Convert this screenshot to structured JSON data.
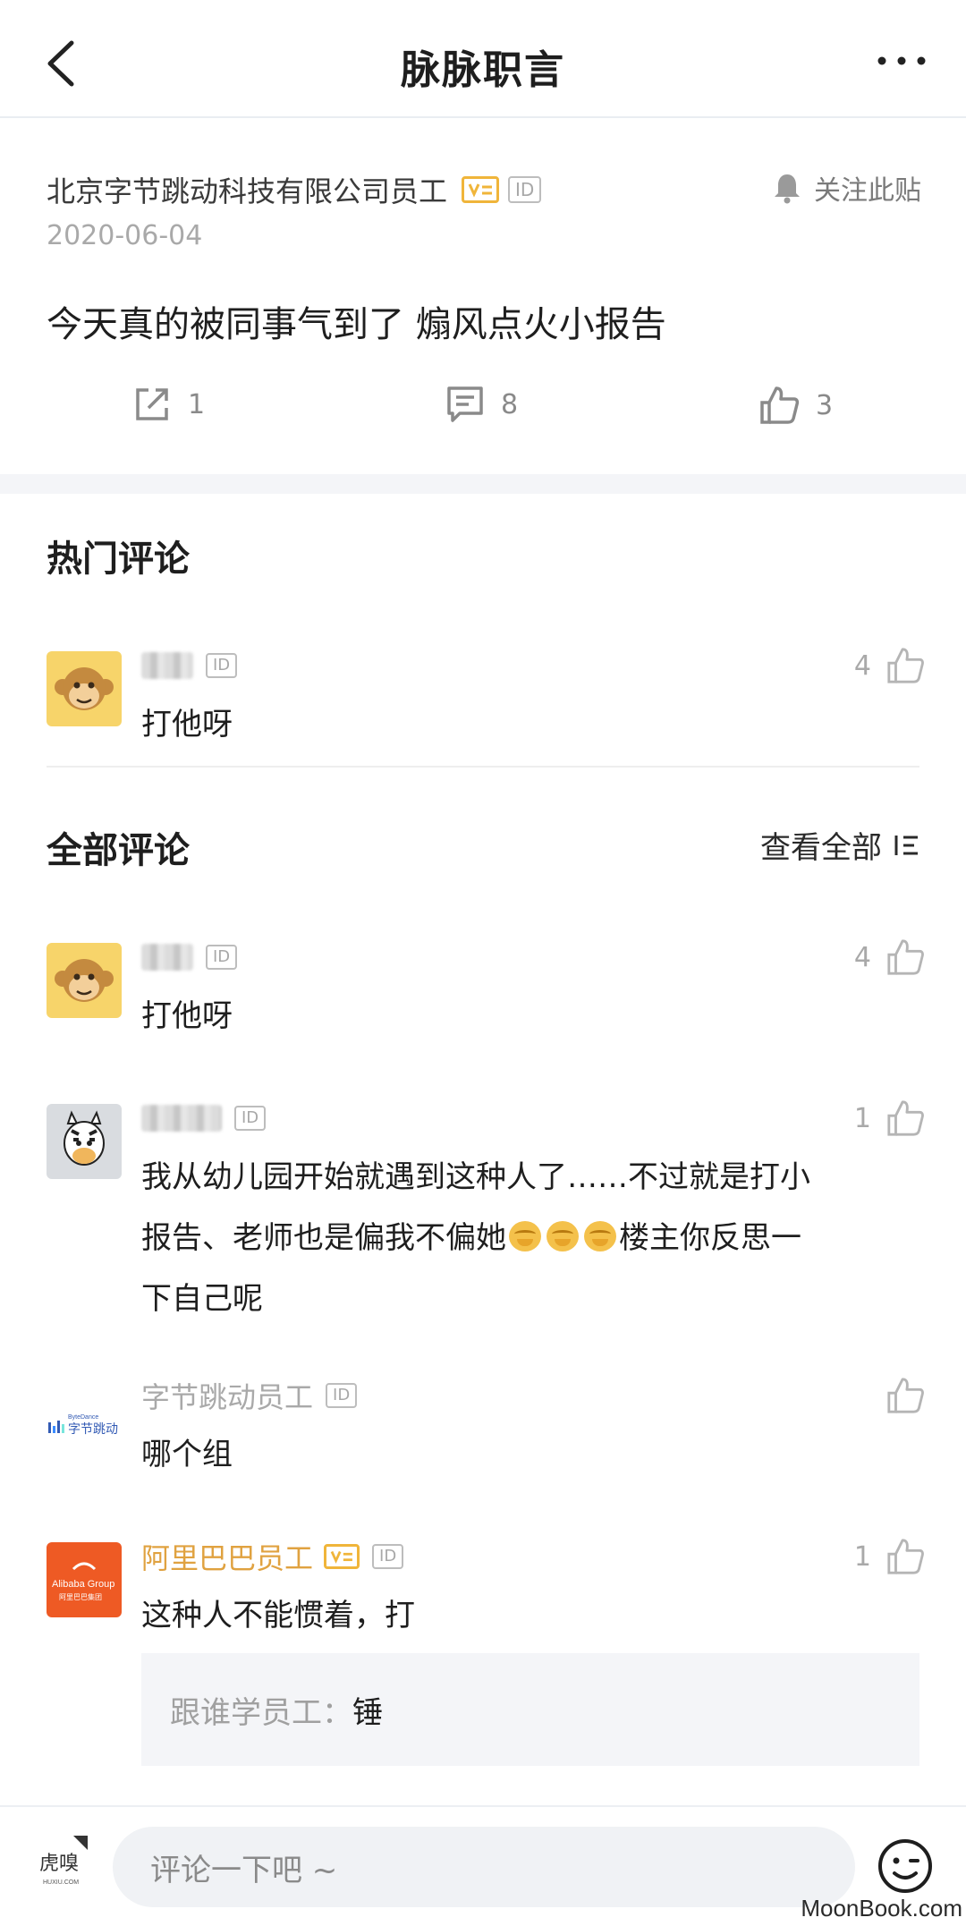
{
  "nav": {
    "title": "脉脉职言"
  },
  "post": {
    "author": "北京字节跳动科技有限公司员工",
    "id_badge": "ID",
    "follow_label": "关注此贴",
    "date": "2020-06-04",
    "content": "今天真的被同事气到了 煽风点火小报告",
    "share_count": "1",
    "comment_count": "8",
    "like_count": "3"
  },
  "hot": {
    "title": "热门评论",
    "comments": [
      {
        "name": "",
        "id_badge": "ID",
        "text": "打他呀",
        "likes": "4"
      }
    ]
  },
  "all": {
    "title": "全部评论",
    "view_all": "查看全部",
    "comments": [
      {
        "name": "",
        "id_badge": "ID",
        "text": "打他呀",
        "likes": "4"
      },
      {
        "name": "",
        "id_badge": "ID",
        "text_a": "我从幼儿园开始就遇到这种人了……不过就是打小",
        "text_b": "报告、老师也是偏我不偏她",
        "text_c": "楼主你反思一",
        "text_d": "下自己呢",
        "likes": "1"
      },
      {
        "name": "字节跳动员工",
        "id_badge": "ID",
        "text": "哪个组",
        "likes": "",
        "avatar_text": "字节跳动",
        "avatar_sub": "ByteDance"
      },
      {
        "name": "阿里巴巴员工",
        "id_badge": "ID",
        "text": "这种人不能惯着，打",
        "likes": "1",
        "avatar_text": "Alibaba Group",
        "avatar_sub": "阿里巴巴集团"
      }
    ],
    "reply": {
      "author": "跟谁学员工：",
      "text": "锤"
    }
  },
  "bottom": {
    "placeholder": "评论一下吧 ~",
    "logo_text": "虎嗅",
    "logo_sub": "HUXIU.COM",
    "watermark": "MoonBook.com"
  },
  "colors": {
    "accent_orange": "#e0a240",
    "muted": "#a9a9a9",
    "bg_gray": "#f4f5f8",
    "alibaba": "#ee5a24"
  },
  "icons": [
    "back-icon",
    "more-icon",
    "bell-icon",
    "share-icon",
    "comment-icon",
    "thumb-up-icon",
    "list-icon",
    "monkey-avatar-icon",
    "zebra-avatar-icon",
    "emoji-face-icon"
  ]
}
